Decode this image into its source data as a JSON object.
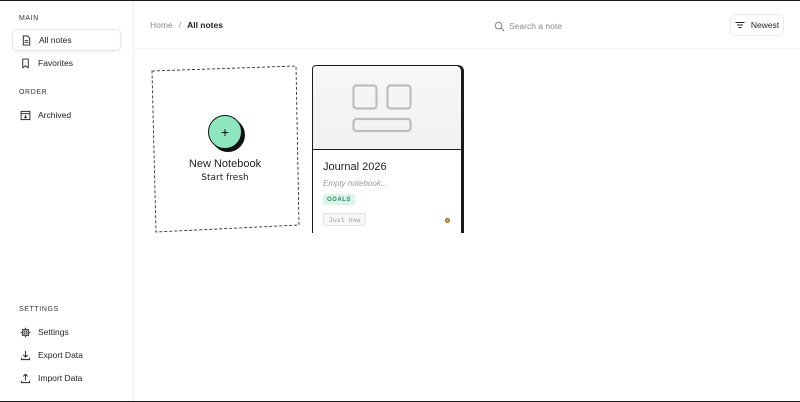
{
  "sidebar": {
    "main_title": "MAIN",
    "order_title": "ORDER",
    "settings_title": "SETTINGS",
    "items": {
      "all_notes": "All notes",
      "favorites": "Favorites",
      "archived": "Archived",
      "settings": "Settings",
      "export_data": "Export Data",
      "import_data": "Import Data"
    }
  },
  "header": {
    "breadcrumb": {
      "home": "Home",
      "separator": "/",
      "current": "All notes"
    },
    "search": {
      "placeholder": "Search a note",
      "value": ""
    },
    "sort_label": "Newest"
  },
  "new_notebook": {
    "plus": "+",
    "title": "New Notebook",
    "subtitle": "Start fresh",
    "accent": "#8ee6bf"
  },
  "notes": [
    {
      "title": "Journal 2026",
      "description": "Empty notebook...",
      "tag": "GOALS",
      "timestamp": "Just now",
      "tag_color": "#d9f5e7",
      "status_color": "#e0a24a"
    }
  ],
  "icons": {
    "all_notes": "document-icon",
    "favorites": "bookmark-icon",
    "archived": "archive-icon",
    "settings": "gear-icon",
    "export": "download-icon",
    "import": "upload-icon",
    "search": "search-icon",
    "sort": "filter-lines-icon"
  }
}
